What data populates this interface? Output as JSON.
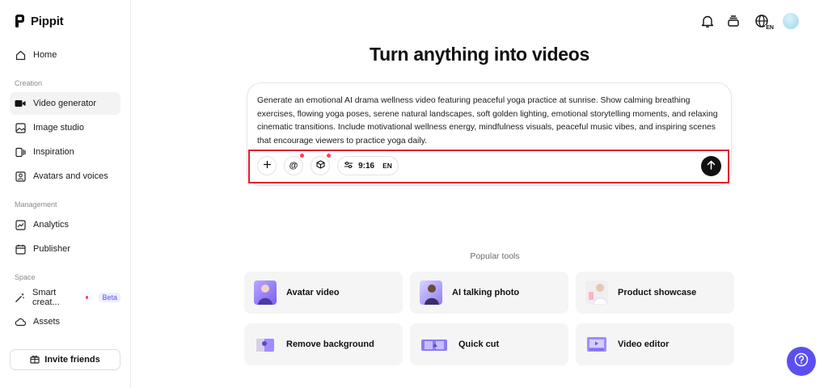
{
  "app": {
    "name": "Pippit"
  },
  "sidebar": {
    "home": "Home",
    "sections": {
      "creation": "Creation",
      "management": "Management",
      "space": "Space"
    },
    "creation_items": [
      "Video generator",
      "Image studio",
      "Inspiration",
      "Avatars and voices"
    ],
    "management_items": [
      "Analytics",
      "Publisher"
    ],
    "space_items": [
      "Smart creat...",
      "Assets"
    ],
    "beta_label": "Beta",
    "invite_label": "Invite friends"
  },
  "header": {
    "icons": [
      "bell-icon",
      "stack-icon",
      "globe-language-icon",
      "avatar"
    ],
    "language_code": "EN"
  },
  "main": {
    "title": "Turn anything into videos",
    "prompt_text": "Generate an emotional AI drama wellness video featuring peaceful yoga practice at sunrise. Show calming breathing exercises, flowing yoga poses, serene natural landscapes, soft golden lighting, emotional storytelling moments, and relaxing cinematic transitions. Include motivational wellness energy, mindfulness visuals, peaceful music vibes, and inspiring scenes that encourage viewers to practice yoga daily.",
    "toolbar": {
      "aspect_ratio": "9:16",
      "language": "EN"
    },
    "popular_label": "Popular tools",
    "tools": [
      "Avatar video",
      "AI talking photo",
      "Product showcase",
      "Remove background",
      "Quick cut",
      "Video editor"
    ]
  },
  "colors": {
    "accent": "#5b4ff0",
    "highlight_border": "#e0232d",
    "badge": "#ff3b5c"
  }
}
